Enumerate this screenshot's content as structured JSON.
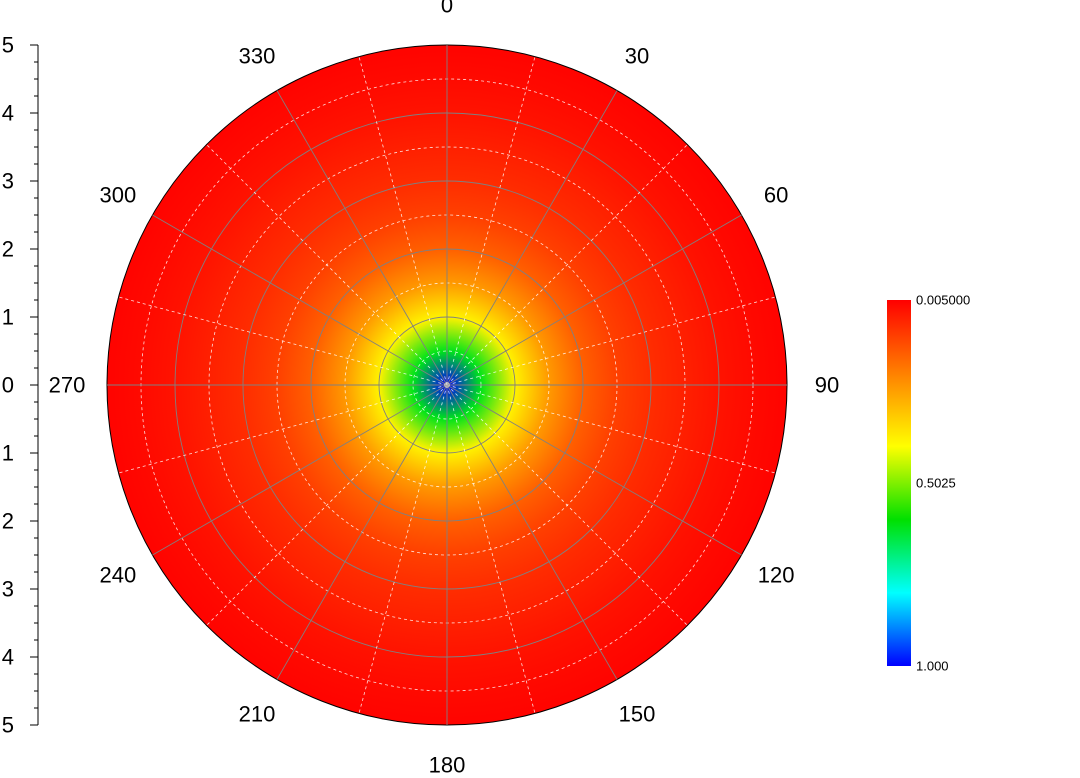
{
  "chart_data": {
    "type": "heatmap",
    "subtype": "polar",
    "title": "",
    "radial_axis": {
      "range": [
        0,
        5
      ],
      "tick_values": [
        5,
        4,
        3,
        2,
        1,
        0,
        1,
        2,
        3,
        4,
        5
      ],
      "tick_labels": [
        "5",
        "4",
        "3",
        "2",
        "1",
        "0",
        "1",
        "2",
        "3",
        "4",
        "5"
      ]
    },
    "angular_axis": {
      "direction": "clockwise",
      "zero_at": "top",
      "tick_values": [
        0,
        30,
        60,
        90,
        120,
        150,
        180,
        210,
        240,
        270,
        300,
        330
      ],
      "tick_labels": [
        "0",
        "30",
        "60",
        "90",
        "120",
        "150",
        "180",
        "210",
        "240",
        "270",
        "300",
        "330"
      ]
    },
    "field": {
      "description_of_variation": "radially symmetric, maximum at center decreasing outward",
      "radius_samples": [
        0,
        0.5,
        1,
        1.5,
        2,
        2.5,
        3,
        3.5,
        4,
        4.5,
        5
      ],
      "values": [
        1.0,
        0.62,
        0.38,
        0.24,
        0.15,
        0.1,
        0.07,
        0.05,
        0.03,
        0.015,
        0.005
      ]
    },
    "colorbar": {
      "position": "right",
      "min": 1.0,
      "max": 0.005,
      "tick_labels": [
        "0.005000",
        "0.5025",
        "1.000"
      ],
      "tick_values": [
        0.005,
        0.5025,
        1.0
      ],
      "colors_top_to_bottom": [
        "#ff0000",
        "#ff8000",
        "#ffff00",
        "#00e000",
        "#00ffff",
        "#0000ff"
      ]
    },
    "grid": true,
    "grid_color": "#808080",
    "minor_grid_color": "#ffffff"
  }
}
